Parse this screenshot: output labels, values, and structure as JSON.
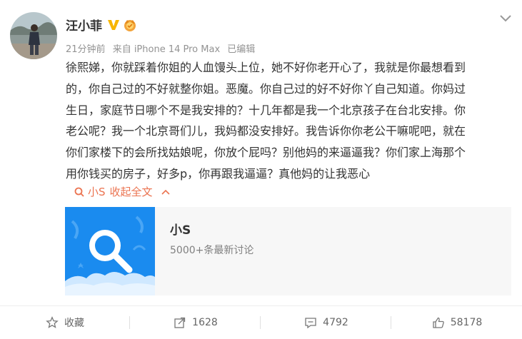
{
  "post": {
    "author": "汪小菲",
    "time": "21分钟前",
    "source": "来自 iPhone 14 Pro Max",
    "edited": "已编辑",
    "body_lines": [
      "徐熙娣，你就踩着你姐的人血馒头上位，她不好你老开心了，我就是你最想看到",
      "的，你自己过的不好就整你姐。恶魔。你自己过的好不好你丫自己知道。你妈过",
      "生日，家庭节日哪个不是我安排的？十几年都是我一个北京孩子在台北安排。你",
      "老公呢？我一个北京哥们儿，我妈都没安排好。我告诉你你老公干嘛呢吧，就在",
      "你们家楼下的会所找姑娘呢，你放个屁吗？别他妈的来逼逼我？你们家上海那个",
      "用你钱买的房子，好多p，你再跟我逼逼？真他妈的让我恶心"
    ],
    "topic_link": "小S",
    "collapse_label": "收起全文"
  },
  "card": {
    "title": "小S",
    "subtitle": "5000+条最新讨论"
  },
  "actions": {
    "favorite_label": "收藏",
    "repost_count": "1628",
    "comment_count": "4792",
    "like_count": "58178"
  },
  "colors": {
    "accent": "#eb7350",
    "verified": "#f7b500",
    "card_bg": "#f7f7f7",
    "card_thumb": "#1a8bef"
  },
  "icons": {
    "verified": "verified-v-icon",
    "crown": "crown-badge-icon",
    "more": "chevron-down-icon",
    "topic": "search-icon",
    "collapse": "chevron-up-icon",
    "favorite": "star-icon",
    "repost": "repost-icon",
    "comment": "comment-icon",
    "like": "thumbs-up-icon"
  }
}
